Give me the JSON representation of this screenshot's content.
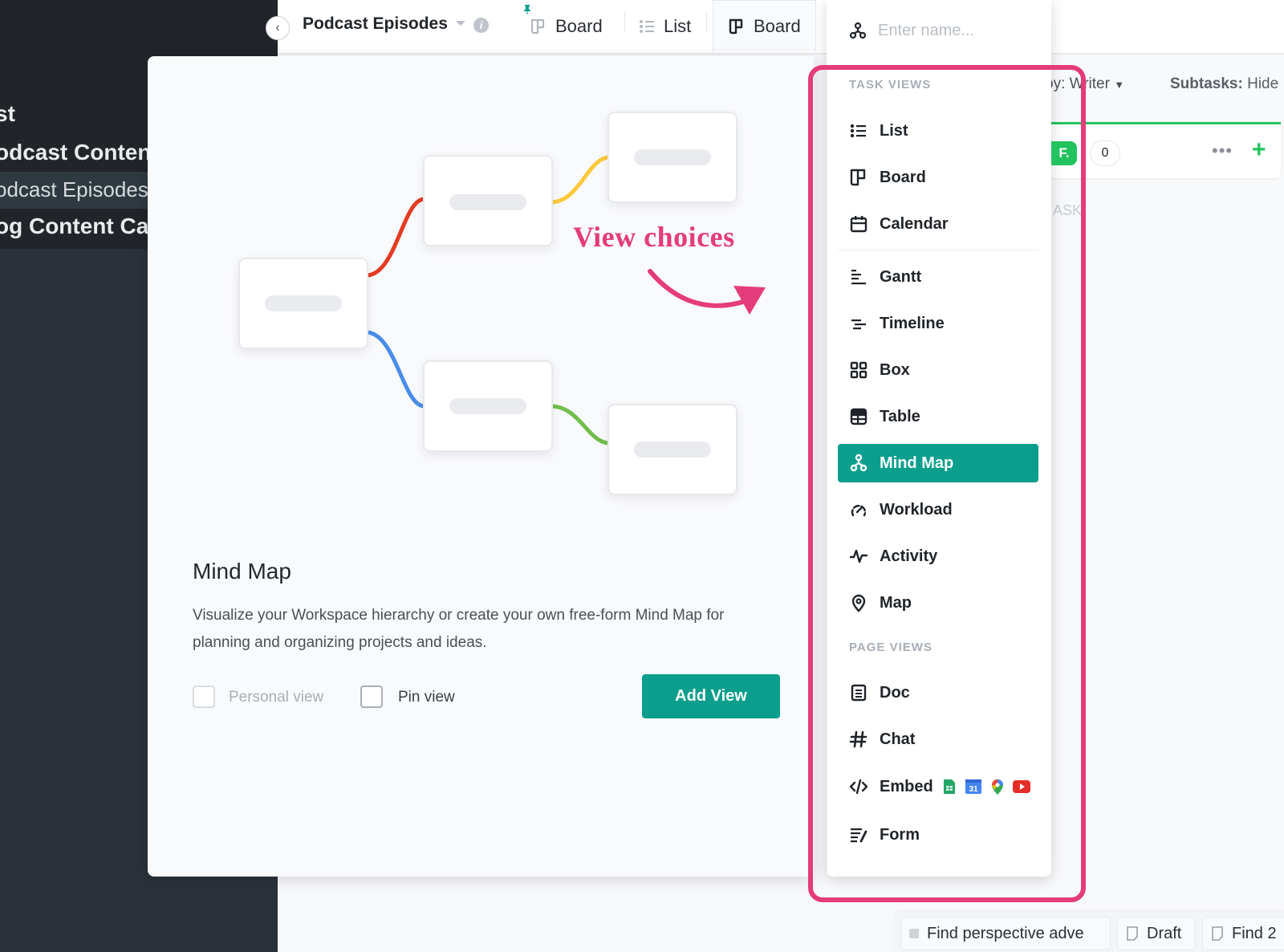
{
  "sidebar": {
    "items": [
      {
        "label": "st",
        "style": "heading"
      },
      {
        "label": "odcast Content",
        "style": "heading"
      },
      {
        "label": "odcast Episodes",
        "style": "active"
      },
      {
        "label": "og Content Cal",
        "style": "heading"
      }
    ]
  },
  "header": {
    "breadcrumb": "Podcast Episodes",
    "info_icon": "i",
    "tabs": [
      {
        "label": "Board",
        "icon": "board-icon",
        "pinned": true
      },
      {
        "label": "List",
        "icon": "list-icon"
      },
      {
        "label": "Board",
        "icon": "board-icon",
        "active": true
      }
    ]
  },
  "modal": {
    "annotation": "View choices",
    "title": "Mind Map",
    "description": "Visualize your Workspace hierarchy or create your own free-form Mind Map for planning and organizing projects and ideas.",
    "personal_view_label": "Personal view",
    "pin_view_label": "Pin view",
    "personal_view_checked": false,
    "pin_view_checked": false,
    "add_view_label": "Add View"
  },
  "panel": {
    "name_placeholder": "Enter name...",
    "task_views_heading": "TASK VIEWS",
    "task_views": [
      {
        "label": "List",
        "icon": "list-icon"
      },
      {
        "label": "Board",
        "icon": "board-icon"
      },
      {
        "label": "Calendar",
        "icon": "calendar-icon"
      },
      {
        "label": "Gantt",
        "icon": "gantt-icon"
      },
      {
        "label": "Timeline",
        "icon": "timeline-icon"
      },
      {
        "label": "Box",
        "icon": "box-icon"
      },
      {
        "label": "Table",
        "icon": "table-icon"
      },
      {
        "label": "Mind Map",
        "icon": "mind-map-icon",
        "selected": true
      },
      {
        "label": "Workload",
        "icon": "workload-icon"
      },
      {
        "label": "Activity",
        "icon": "activity-icon"
      },
      {
        "label": "Map",
        "icon": "map-pin-icon"
      }
    ],
    "page_views_heading": "PAGE VIEWS",
    "page_views": [
      {
        "label": "Doc",
        "icon": "doc-icon"
      },
      {
        "label": "Chat",
        "icon": "hash-icon"
      },
      {
        "label": "Embed",
        "icon": "code-icon",
        "extras": [
          "google-sheets-icon",
          "google-calendar-icon",
          "google-maps-icon",
          "youtube-icon"
        ]
      },
      {
        "label": "Form",
        "icon": "form-icon"
      }
    ],
    "calendar_badge": "31"
  },
  "board": {
    "group_by_prefix": "by:",
    "group_by_value": "Writer",
    "subtasks_label": "Subtasks:",
    "subtasks_value": "Hide",
    "column_badge": "F.",
    "column_count": "0",
    "more_label": "•••",
    "add_label": "+",
    "task_ghost": "ASK"
  },
  "tray": {
    "chips": [
      {
        "label": "Find perspective adve",
        "icon": "status-square-icon"
      },
      {
        "label": "Draft",
        "icon": "page-icon"
      },
      {
        "label": "Find 2",
        "icon": "page-icon"
      }
    ]
  },
  "colors": {
    "accent": "#0a9e8d",
    "highlight": "#e43c7a",
    "sidebar_bg": "#2b3139",
    "mindmap_red": "#e33b22",
    "mindmap_yellow": "#fcc93c",
    "mindmap_blue": "#4a8de8",
    "mindmap_green": "#72be4d",
    "board_green": "#22c35e"
  }
}
